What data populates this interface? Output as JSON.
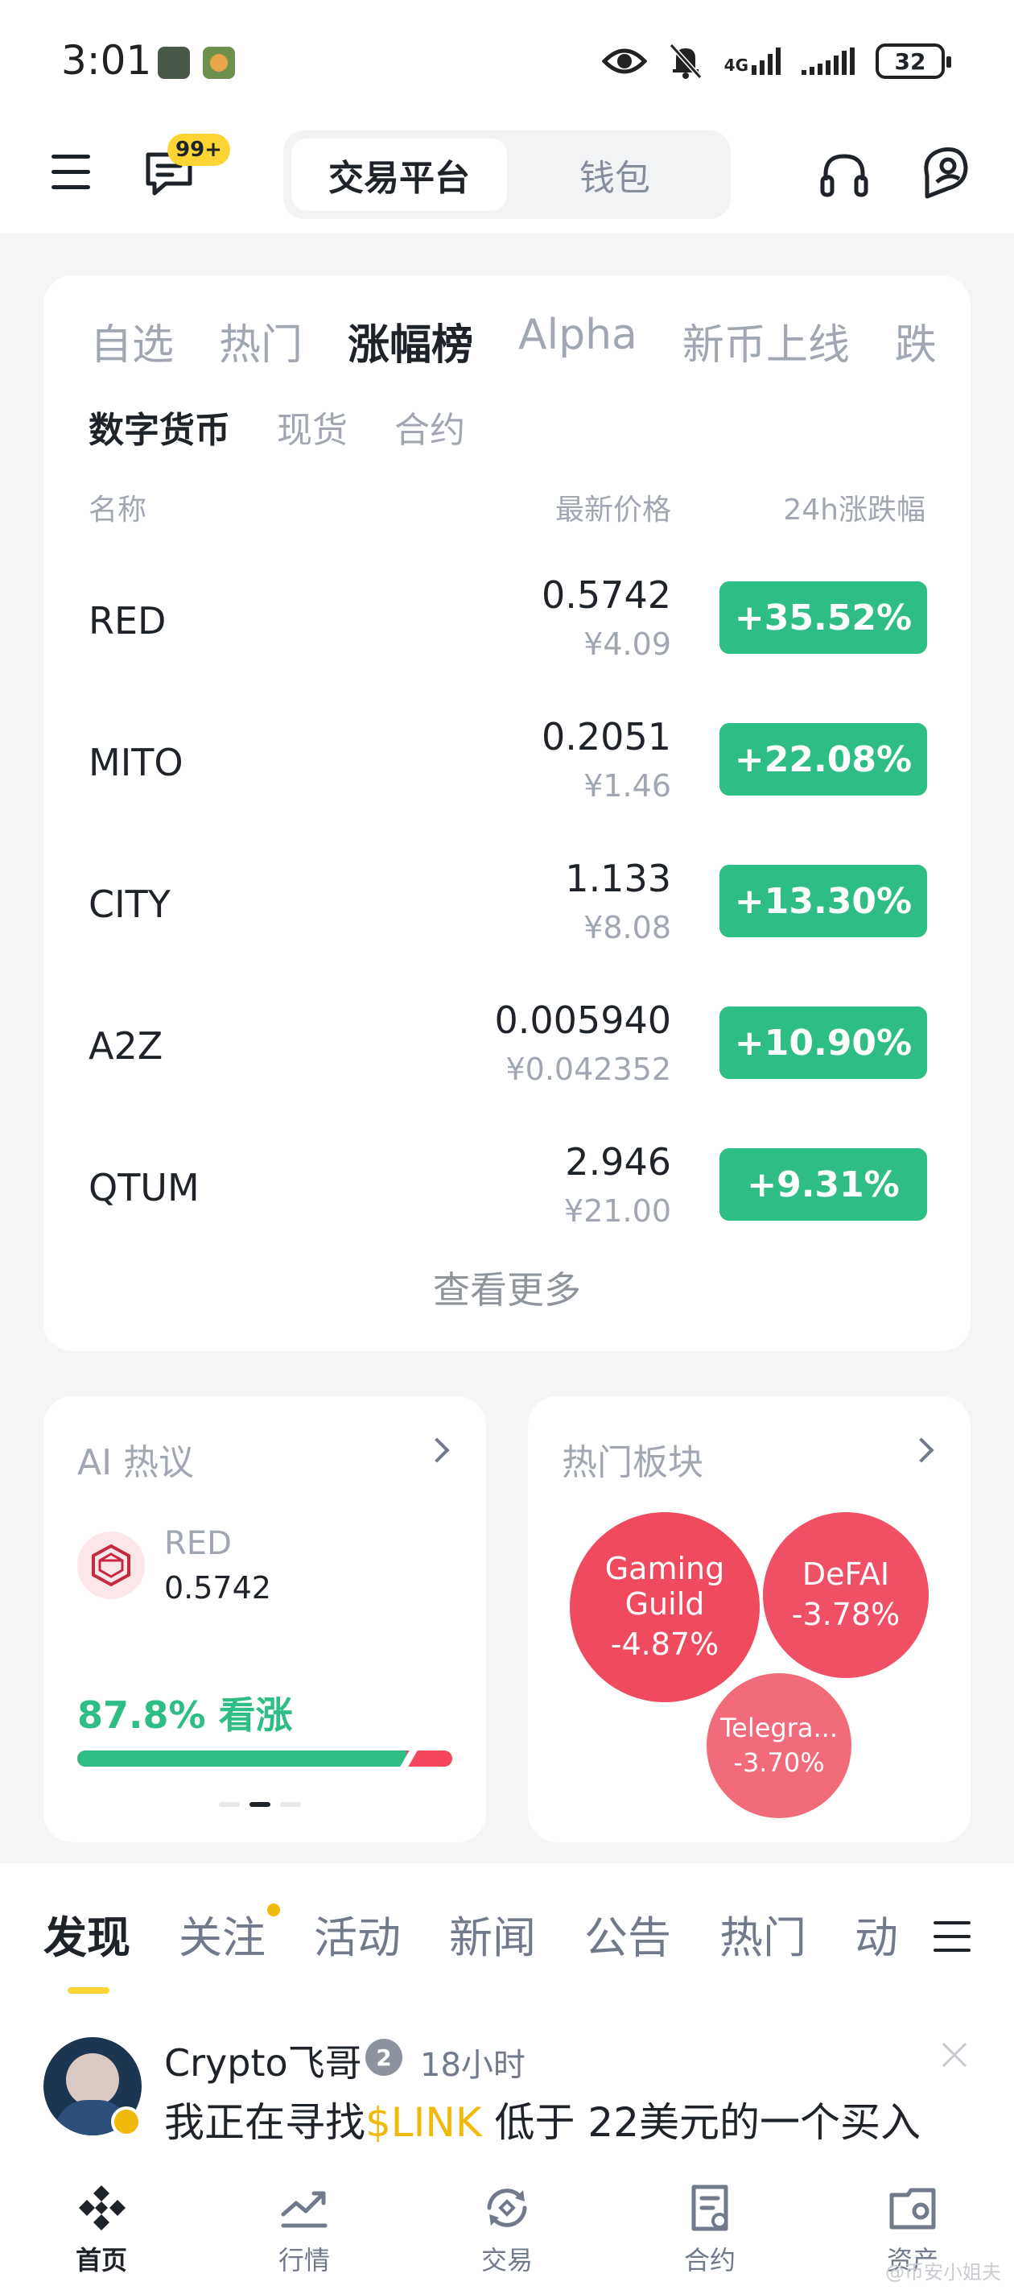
{
  "status_bar": {
    "time": "3:01",
    "net_label": "4G",
    "battery": "32"
  },
  "header": {
    "badge": "99+",
    "segments": [
      "交易平台",
      "钱包"
    ],
    "active_segment": "交易平台"
  },
  "ranking": {
    "tabs": [
      "自选",
      "热门",
      "涨幅榜",
      "Alpha",
      "新币上线",
      "跌"
    ],
    "active_tab": "涨幅榜",
    "subtabs": [
      "数字货币",
      "现货",
      "合约"
    ],
    "active_subtab": "数字货币",
    "columns": {
      "name": "名称",
      "price": "最新价格",
      "change": "24h涨跌幅"
    },
    "rows": [
      {
        "name": "RED",
        "price": "0.5742",
        "cny": "¥4.09",
        "change": "+35.52%"
      },
      {
        "name": "MITO",
        "price": "0.2051",
        "cny": "¥1.46",
        "change": "+22.08%"
      },
      {
        "name": "CITY",
        "price": "1.133",
        "cny": "¥8.08",
        "change": "+13.30%"
      },
      {
        "name": "A2Z",
        "price": "0.005940",
        "cny": "¥0.042352",
        "change": "+10.90%"
      },
      {
        "name": "QTUM",
        "price": "2.946",
        "cny": "¥21.00",
        "change": "+9.31%"
      }
    ],
    "more": "查看更多"
  },
  "ai_card": {
    "title": "AI 热议",
    "coin": "RED",
    "price": "0.5742",
    "sentiment": "87.8% 看涨",
    "bull_fraction": 0.878
  },
  "hot_sectors": {
    "title": "热门板块",
    "bubbles": [
      {
        "name": "Gaming Guild",
        "change": "-4.87%"
      },
      {
        "name": "DeFAI",
        "change": "-3.78%"
      },
      {
        "name": "Telegra...",
        "change": "-3.70%"
      }
    ]
  },
  "feed": {
    "tabs": [
      "发现",
      "关注",
      "活动",
      "新闻",
      "公告",
      "热门",
      "动"
    ],
    "active_tab": "发现",
    "post": {
      "author": "Crypto飞哥",
      "level": "2",
      "time": "18小时",
      "text_before": "我正在寻找",
      "tag": "$LINK",
      "text_after": " 低于 22美元的一个买入"
    }
  },
  "bottom_nav": {
    "items": [
      "首页",
      "行情",
      "交易",
      "合约",
      "资产"
    ],
    "active": "首页"
  },
  "watermark": "@币安小姐夫"
}
